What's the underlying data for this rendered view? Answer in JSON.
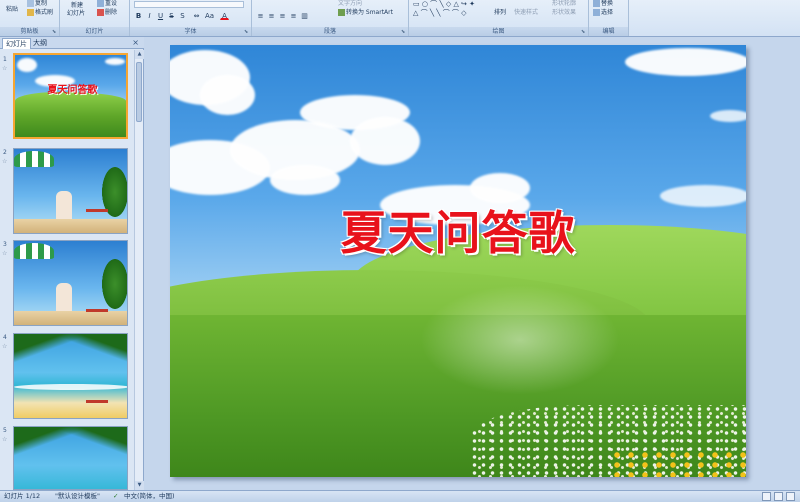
{
  "ribbon": {
    "groups": {
      "clipboard": "剪贴板",
      "slides": "幻灯片",
      "font": "字体",
      "paragraph": "段落",
      "drawing": "绘图",
      "editing": "编辑"
    },
    "clipboard": {
      "paste": "粘贴",
      "copy": "复制",
      "format_painter": "格式刷"
    },
    "slides": {
      "new_slide": "新建",
      "new_slide_2": "幻灯片",
      "reset": "重设",
      "delete": "删除"
    },
    "font": {
      "bold": "B",
      "italic": "I",
      "underline": "U",
      "strike": "S",
      "shadow": "S"
    },
    "paragraph": {
      "text_direction": "文字方向",
      "convert_smartart": "转换为 SmartArt"
    },
    "drawing": {
      "arrange": "排列",
      "quick_styles": "快速样式",
      "shape_fill": "形状轮廓",
      "shape_effects": "形状效果"
    },
    "editing": {
      "replace": "替换",
      "select": "选择"
    }
  },
  "left_panel": {
    "tabs": [
      "幻灯片",
      "大纲"
    ],
    "close_glyph": "×",
    "slides": [
      {
        "num": "1",
        "title": "夏天问答歌"
      },
      {
        "num": "2"
      },
      {
        "num": "3"
      },
      {
        "num": "4"
      },
      {
        "num": "5"
      }
    ]
  },
  "slide": {
    "title": "夏天问答歌"
  },
  "status": {
    "slide_count": "幻灯片 1/12",
    "theme": "\"默认设计模板\"",
    "language": "中文(简体，中国)"
  }
}
